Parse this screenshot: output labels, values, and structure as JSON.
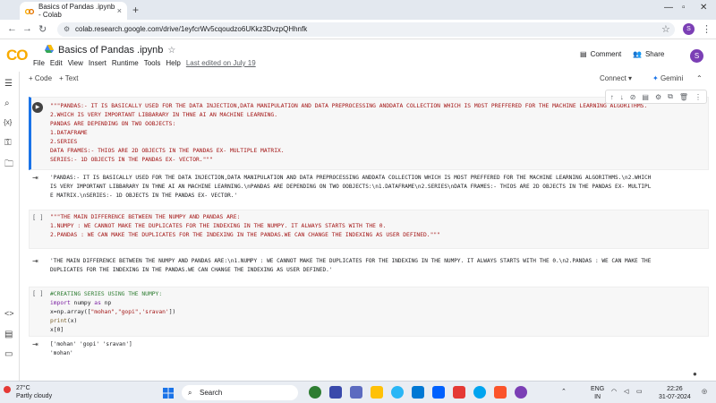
{
  "browser": {
    "tab_title": "Basics of Pandas .ipynb - Colab",
    "tab_close": "×",
    "new_tab": "+",
    "url": "colab.research.google.com/drive/1eyfcrWv5cqoudzo6UKkz3DvzpQHhnfk",
    "profile_initial": "S"
  },
  "colab": {
    "logo": "CO",
    "notebook_title": "Basics of Pandas .ipynb",
    "menu": [
      "File",
      "Edit",
      "View",
      "Insert",
      "Runtime",
      "Tools",
      "Help"
    ],
    "last_edited": "Last edited on July 19",
    "comment_label": "Comment",
    "share_label": "Share",
    "avatar_initial": "S",
    "add_code": "+ Code",
    "add_text": "+ Text",
    "connect_label": "Connect",
    "gemini_label": "Gemini"
  },
  "cells": {
    "c1_code": "\"\"\"PANDAS:- IT IS BASICALLY USED FOR THE DATA INJECTION,DATA MANIPULATION AND DATA PREPROCESSING ANDDATA COLLECTION WHICH IS MOST PREFFERED FOR THE MACHINE LEARNING ALGORITHMS.\n2.WHICH IS VERY IMPORTANT LIBBARARY IN THNE AI AN MACHINE LEARNING.\nPANDAS ARE DEPENDING ON TWO OOBJECTS:\n1.DATAFRAME\n2.SERIES\nDATA FRAMES:- THIOS ARE 2D OBJECTS IN THE PANDAS EX- MULTIPLE MATRIX.\nSERIES:- 1D OBJECTS IN THE PANDAS EX- VECTOR.\"\"\"",
    "c1_output": "'PANDAS:- IT IS BASICALLY USED FOR THE DATA INJECTION,DATA MANIPULATION AND DATA PREPROCESSING ANDDATA COLLECTION WHICH IS MOST PREFFERED FOR THE MACHINE LEARNING ALGORITHMS.\\n2.WHICH\nIS VERY IMPORTANT LIBBARARY IN THNE AI AN MACHINE LEARNING.\\nPANDAS ARE DEPENDING ON TWO OOBJECTS:\\n1.DATAFRAME\\n2.SERIES\\nDATA FRAMES:- THIOS ARE 2D OBJECTS IN THE PANDAS EX- MULTIPL\nE MATRIX.\\nSERIES:- 1D OBJECTS IN THE PANDAS EX- VECTOR.'",
    "c2_prompt": "[ ]",
    "c2_code": "\"\"\"THE MAIN DIFFERENCE BETWEEN THE NUMPY AND PANDAS ARE:\n1.NUMPY : WE CANNOT MAKE THE DUPLICATES FOR THE INDEXING IN THE NUMPY. IT ALWAYS STARTS WITH THE 0.\n2.PANDAS : WE CAN MAKE THE DUPLICATES FOR THE INDEXING IN THE PANDAS.WE CAN CHANGE THE INDEXING AS USER DEFINED.\"\"\"",
    "c2_output": "'THE MAIN DIFFERENCE BETWEEN THE NUMPY AND PANDAS ARE:\\n1.NUMPY : WE CANNOT MAKE THE DUPLICATES FOR THE INDEXING IN THE NUMPY. IT ALWAYS STARTS WITH THE 0.\\n2.PANDAS : WE CAN MAKE THE\nDUPLICATES FOR THE INDEXING IN THE PANDAS.WE CAN CHANGE THE INDEXING AS USER DEFINED.'",
    "c3_prompt": "[ ]",
    "c3_l1": "#CREATING SERIES USING THE NUMPY:",
    "c3_l2_kw1": "import",
    "c3_l2_mid": " numpy ",
    "c3_l2_kw2": "as",
    "c3_l2_end": " np",
    "c3_l3": "x=np.array([",
    "c3_l3_s": "\"mohan\",\"gopi\",'sravan'",
    "c3_l3_end": "])",
    "c3_l4_fn": "print",
    "c3_l4_end": "(x)",
    "c3_l5": "x[0]",
    "c3_output": "['mohan' 'gopi' 'sravan']\n'mohan'"
  },
  "taskbar": {
    "temp": "27°C",
    "weather": "Partly cloudy",
    "search": "Search",
    "lang1": "ENG",
    "lang2": "IN",
    "time": "22:26",
    "date": "31-07-2024"
  },
  "colors": {
    "accent": "#1a73e8",
    "colab_orange": "#f9ab00",
    "string_red": "#a31515"
  }
}
